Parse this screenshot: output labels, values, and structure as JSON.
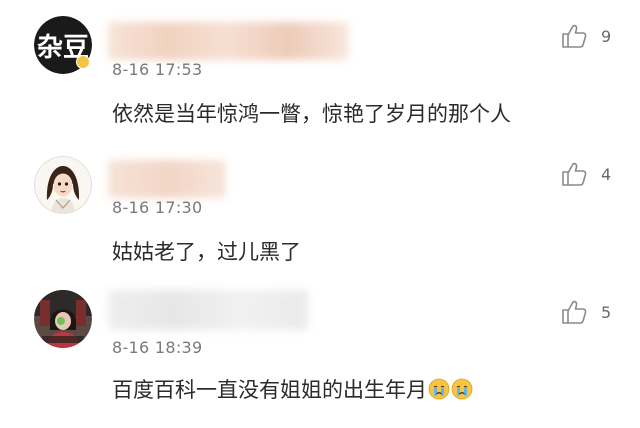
{
  "comments": [
    {
      "avatar_label": "杂豆",
      "time": "8-16 17:53",
      "text": "依然是当年惊鸿一瞥，惊艳了岁月的那个人",
      "likes": "9",
      "emojis": []
    },
    {
      "avatar_label": "",
      "time": "8-16 17:30",
      "text": "姑姑老了，过儿黑了",
      "likes": "4",
      "emojis": []
    },
    {
      "avatar_label": "",
      "time": "8-16 18:39",
      "text": "百度百科一直没有姐姐的出生年月",
      "likes": "5",
      "emojis": [
        "crying-face",
        "crying-face"
      ]
    }
  ],
  "icons": {
    "like": "thumbs-up-icon",
    "verified": "verified-badge-icon",
    "emoji": "crying-face-emoji"
  },
  "colors": {
    "text": "#2b2b2b",
    "time": "#7a7a7a",
    "name_blur": "#f3d3c0",
    "verified": "#f5c243"
  }
}
